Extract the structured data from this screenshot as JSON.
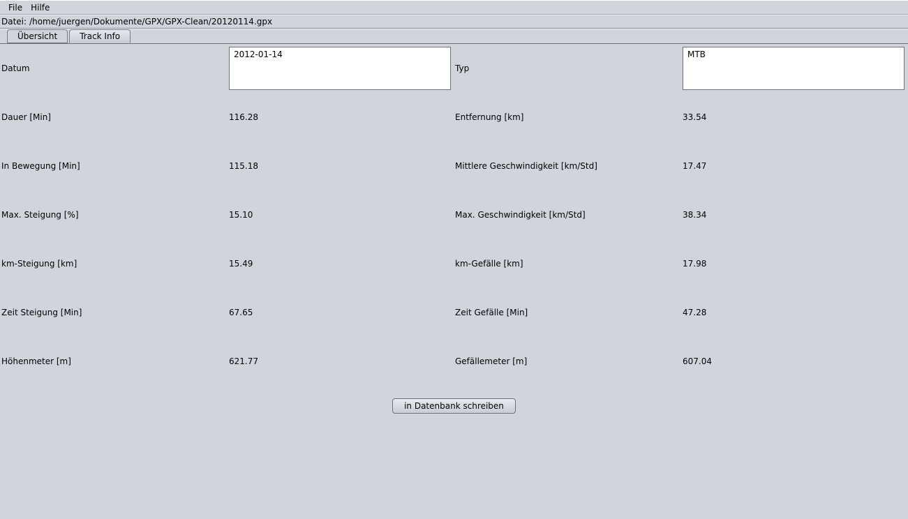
{
  "menu": {
    "file": "File",
    "help": "Hilfe"
  },
  "file_line": {
    "prefix": "Datei:",
    "path": "/home/juergen/Dokumente/GPX/GPX-Clean/20120114.gpx"
  },
  "tabs": {
    "overview": "Übersicht",
    "trackinfo": "Track Info"
  },
  "fields": {
    "datum": {
      "label": "Datum",
      "value": "2012-01-14"
    },
    "typ": {
      "label": "Typ",
      "value": "MTB"
    },
    "dauer": {
      "label": "Dauer [Min]",
      "value": "116.28"
    },
    "entfernung": {
      "label": "Entfernung [km]",
      "value": "33.54"
    },
    "inbewegung": {
      "label": "In Bewegung [Min]",
      "value": "115.18"
    },
    "mittgeschw": {
      "label": "Mittlere Geschwindigkeit [km/Std]",
      "value": "17.47"
    },
    "maxsteig": {
      "label": "Max. Steigung [%]",
      "value": "15.10"
    },
    "maxgeschw": {
      "label": "Max. Geschwindigkeit [km/Std]",
      "value": "38.34"
    },
    "kmsteig": {
      "label": "km-Steigung [km]",
      "value": "15.49"
    },
    "kmgefaelle": {
      "label": "km-Gefälle [km]",
      "value": "17.98"
    },
    "zeitsteig": {
      "label": "Zeit Steigung [Min]",
      "value": "67.65"
    },
    "zeitgefaelle": {
      "label": "Zeit Gefälle [Min]",
      "value": "47.28"
    },
    "hoehenmeter": {
      "label": "Höhenmeter [m]",
      "value": "621.77"
    },
    "gefaellemeter": {
      "label": "Gefällemeter [m]",
      "value": "607.04"
    }
  },
  "button": {
    "write_db": "in Datenbank schreiben"
  }
}
